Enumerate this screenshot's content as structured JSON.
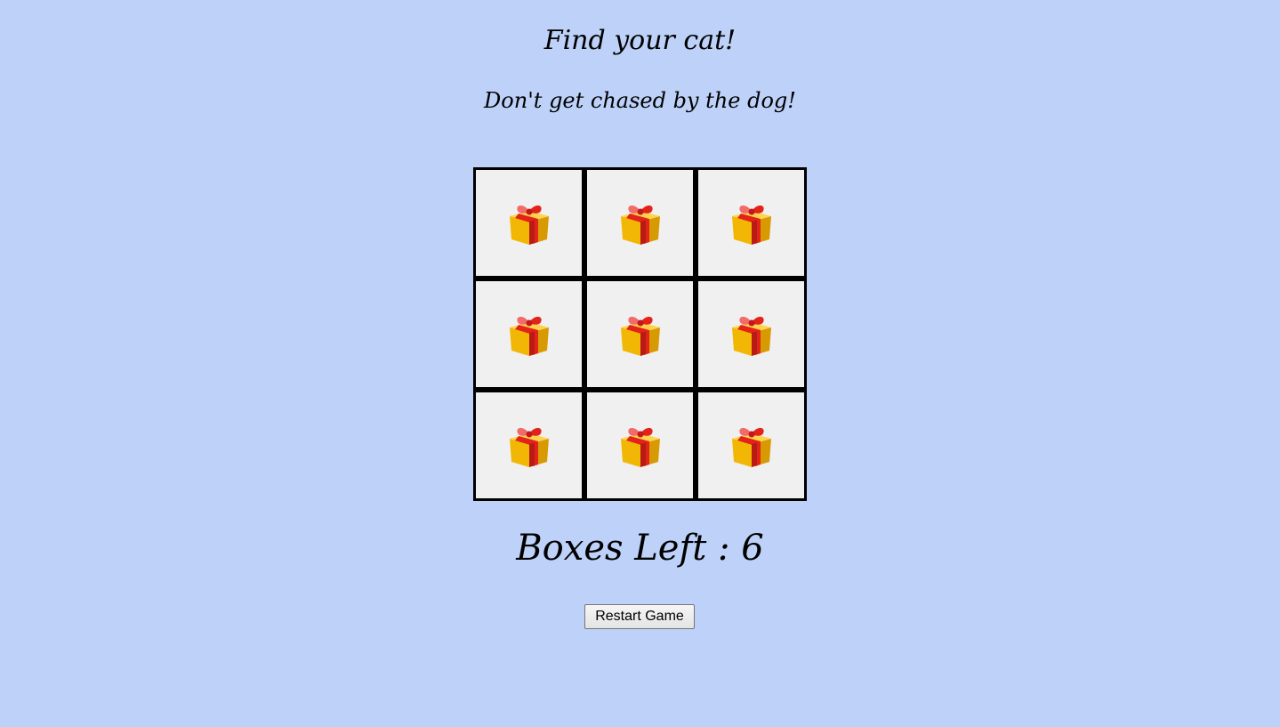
{
  "header": {
    "title": "Find your cat!",
    "subtitle": "Don't get chased by the dog!"
  },
  "board": {
    "box_icon": "gift-box-icon",
    "boxes": [
      {
        "state": "closed"
      },
      {
        "state": "closed"
      },
      {
        "state": "closed"
      },
      {
        "state": "closed"
      },
      {
        "state": "closed"
      },
      {
        "state": "closed"
      },
      {
        "state": "closed"
      },
      {
        "state": "closed"
      },
      {
        "state": "closed"
      }
    ]
  },
  "status": {
    "boxes_left_label": "Boxes Left : 6"
  },
  "controls": {
    "restart_label": "Restart Game"
  },
  "colors": {
    "background": "#bdd1f9",
    "box_fill": "#f0f0f0",
    "box_border": "#000000",
    "gift_box": "#f2b705",
    "gift_ribbon": "#e2231a"
  }
}
